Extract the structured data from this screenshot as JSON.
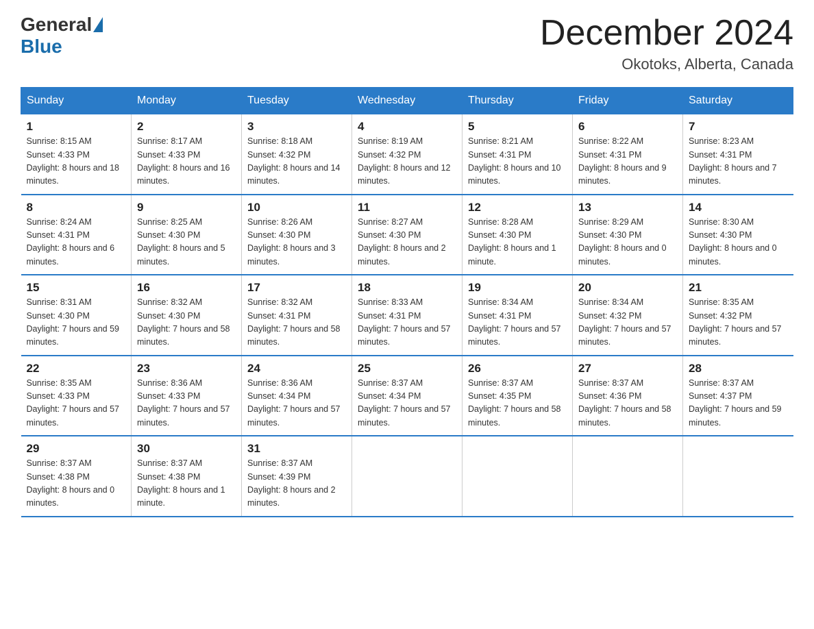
{
  "header": {
    "logo_general": "General",
    "logo_blue": "Blue",
    "month_title": "December 2024",
    "location": "Okotoks, Alberta, Canada"
  },
  "days_of_week": [
    "Sunday",
    "Monday",
    "Tuesday",
    "Wednesday",
    "Thursday",
    "Friday",
    "Saturday"
  ],
  "weeks": [
    [
      {
        "day": "1",
        "sunrise": "8:15 AM",
        "sunset": "4:33 PM",
        "daylight": "8 hours and 18 minutes."
      },
      {
        "day": "2",
        "sunrise": "8:17 AM",
        "sunset": "4:33 PM",
        "daylight": "8 hours and 16 minutes."
      },
      {
        "day": "3",
        "sunrise": "8:18 AM",
        "sunset": "4:32 PM",
        "daylight": "8 hours and 14 minutes."
      },
      {
        "day": "4",
        "sunrise": "8:19 AM",
        "sunset": "4:32 PM",
        "daylight": "8 hours and 12 minutes."
      },
      {
        "day": "5",
        "sunrise": "8:21 AM",
        "sunset": "4:31 PM",
        "daylight": "8 hours and 10 minutes."
      },
      {
        "day": "6",
        "sunrise": "8:22 AM",
        "sunset": "4:31 PM",
        "daylight": "8 hours and 9 minutes."
      },
      {
        "day": "7",
        "sunrise": "8:23 AM",
        "sunset": "4:31 PM",
        "daylight": "8 hours and 7 minutes."
      }
    ],
    [
      {
        "day": "8",
        "sunrise": "8:24 AM",
        "sunset": "4:31 PM",
        "daylight": "8 hours and 6 minutes."
      },
      {
        "day": "9",
        "sunrise": "8:25 AM",
        "sunset": "4:30 PM",
        "daylight": "8 hours and 5 minutes."
      },
      {
        "day": "10",
        "sunrise": "8:26 AM",
        "sunset": "4:30 PM",
        "daylight": "8 hours and 3 minutes."
      },
      {
        "day": "11",
        "sunrise": "8:27 AM",
        "sunset": "4:30 PM",
        "daylight": "8 hours and 2 minutes."
      },
      {
        "day": "12",
        "sunrise": "8:28 AM",
        "sunset": "4:30 PM",
        "daylight": "8 hours and 1 minute."
      },
      {
        "day": "13",
        "sunrise": "8:29 AM",
        "sunset": "4:30 PM",
        "daylight": "8 hours and 0 minutes."
      },
      {
        "day": "14",
        "sunrise": "8:30 AM",
        "sunset": "4:30 PM",
        "daylight": "8 hours and 0 minutes."
      }
    ],
    [
      {
        "day": "15",
        "sunrise": "8:31 AM",
        "sunset": "4:30 PM",
        "daylight": "7 hours and 59 minutes."
      },
      {
        "day": "16",
        "sunrise": "8:32 AM",
        "sunset": "4:30 PM",
        "daylight": "7 hours and 58 minutes."
      },
      {
        "day": "17",
        "sunrise": "8:32 AM",
        "sunset": "4:31 PM",
        "daylight": "7 hours and 58 minutes."
      },
      {
        "day": "18",
        "sunrise": "8:33 AM",
        "sunset": "4:31 PM",
        "daylight": "7 hours and 57 minutes."
      },
      {
        "day": "19",
        "sunrise": "8:34 AM",
        "sunset": "4:31 PM",
        "daylight": "7 hours and 57 minutes."
      },
      {
        "day": "20",
        "sunrise": "8:34 AM",
        "sunset": "4:32 PM",
        "daylight": "7 hours and 57 minutes."
      },
      {
        "day": "21",
        "sunrise": "8:35 AM",
        "sunset": "4:32 PM",
        "daylight": "7 hours and 57 minutes."
      }
    ],
    [
      {
        "day": "22",
        "sunrise": "8:35 AM",
        "sunset": "4:33 PM",
        "daylight": "7 hours and 57 minutes."
      },
      {
        "day": "23",
        "sunrise": "8:36 AM",
        "sunset": "4:33 PM",
        "daylight": "7 hours and 57 minutes."
      },
      {
        "day": "24",
        "sunrise": "8:36 AM",
        "sunset": "4:34 PM",
        "daylight": "7 hours and 57 minutes."
      },
      {
        "day": "25",
        "sunrise": "8:37 AM",
        "sunset": "4:34 PM",
        "daylight": "7 hours and 57 minutes."
      },
      {
        "day": "26",
        "sunrise": "8:37 AM",
        "sunset": "4:35 PM",
        "daylight": "7 hours and 58 minutes."
      },
      {
        "day": "27",
        "sunrise": "8:37 AM",
        "sunset": "4:36 PM",
        "daylight": "7 hours and 58 minutes."
      },
      {
        "day": "28",
        "sunrise": "8:37 AM",
        "sunset": "4:37 PM",
        "daylight": "7 hours and 59 minutes."
      }
    ],
    [
      {
        "day": "29",
        "sunrise": "8:37 AM",
        "sunset": "4:38 PM",
        "daylight": "8 hours and 0 minutes."
      },
      {
        "day": "30",
        "sunrise": "8:37 AM",
        "sunset": "4:38 PM",
        "daylight": "8 hours and 1 minute."
      },
      {
        "day": "31",
        "sunrise": "8:37 AM",
        "sunset": "4:39 PM",
        "daylight": "8 hours and 2 minutes."
      },
      null,
      null,
      null,
      null
    ]
  ],
  "labels": {
    "sunrise": "Sunrise:",
    "sunset": "Sunset:",
    "daylight": "Daylight:"
  }
}
